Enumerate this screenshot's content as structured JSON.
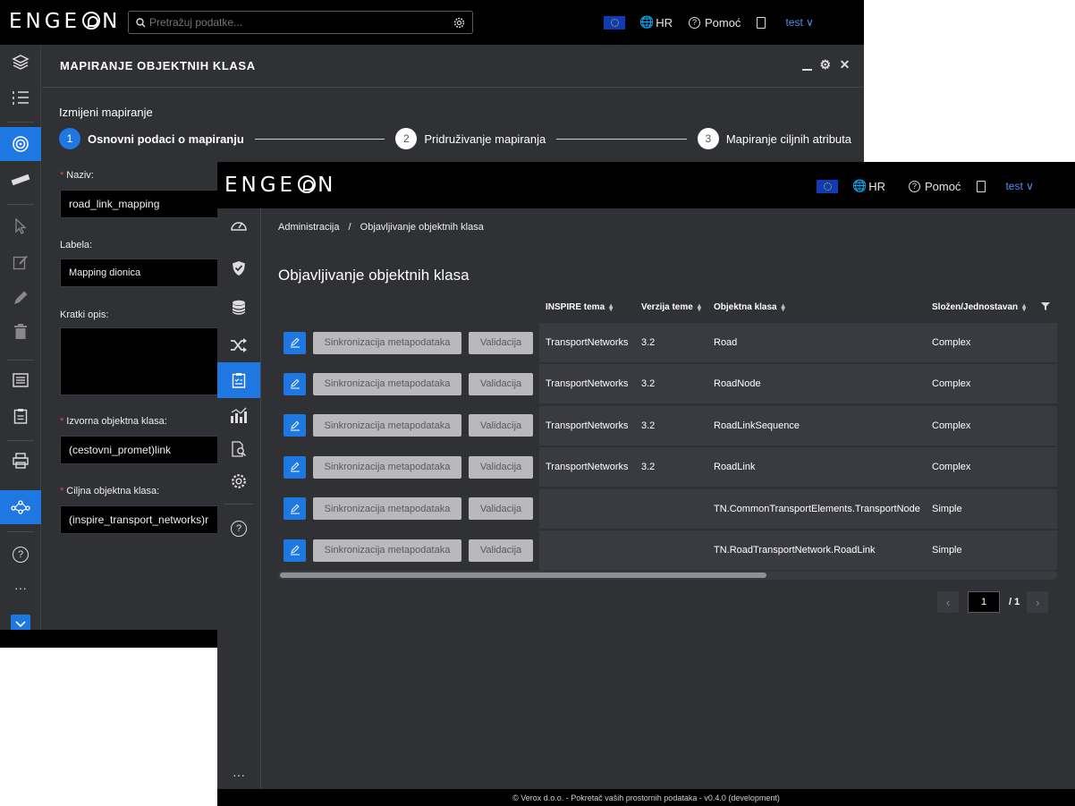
{
  "app": {
    "logo": "ENGEON",
    "language": "HR",
    "help_label": "Pomoć",
    "user_label": "test",
    "accent_color": "#1f78e1"
  },
  "search": {
    "placeholder": "Pretražuj podatke..."
  },
  "mapping_window": {
    "title": "MAPIRANJE OBJEKTNIH KLASA",
    "window_controls": [
      "minimize-icon",
      "gear-icon",
      "close-icon"
    ],
    "subtitle": "Izmijeni mapiranje",
    "steps": [
      {
        "num": "1",
        "label": "Osnovni podaci o mapiranju",
        "state": "current"
      },
      {
        "num": "2",
        "label": "Pridruživanje mapiranja",
        "state": "pending"
      },
      {
        "num": "3",
        "label": "Mapiranje ciljnih atributa",
        "state": "pending"
      }
    ],
    "fields": {
      "naziv": {
        "label": "Naziv:",
        "required": true,
        "value": "road_link_mapping"
      },
      "labela": {
        "label": "Labela:",
        "required": false,
        "value": "Mapping dionica"
      },
      "opis": {
        "label": "Kratki opis:",
        "required": false,
        "value": ""
      },
      "izvorna": {
        "label": "Izvorna objektna klasa:",
        "required": true,
        "value": "(cestovni_promet)link"
      },
      "ciljna": {
        "label": "Ciljna objektna klasa:",
        "required": true,
        "value": "(inspire_transport_networks)r"
      }
    }
  },
  "publish_window": {
    "breadcrumb": {
      "root": "Administracija",
      "separator": "/",
      "current": "Objavljivanje objektnih klasa"
    },
    "title": "Objavljivanje objektnih klasa",
    "columns": {
      "theme": "INSPIRE tema",
      "version": "Verzija teme",
      "class": "Objektna klasa",
      "type": "Složen/Jednostavan"
    },
    "actions": {
      "sync": "Sinkronizacija metapodataka",
      "validate": "Validacija"
    },
    "rows": [
      {
        "theme": "TransportNetworks",
        "version": "3.2",
        "class": "Road",
        "type": "Complex"
      },
      {
        "theme": "TransportNetworks",
        "version": "3.2",
        "class": "RoadNode",
        "type": "Complex"
      },
      {
        "theme": "TransportNetworks",
        "version": "3.2",
        "class": "RoadLinkSequence",
        "type": "Complex"
      },
      {
        "theme": "TransportNetworks",
        "version": "3.2",
        "class": "RoadLink",
        "type": "Complex"
      },
      {
        "theme": "",
        "version": "",
        "class": "TN.CommonTransportElements.TransportNode",
        "type": "Simple"
      },
      {
        "theme": "",
        "version": "",
        "class": "TN.RoadTransportNetwork.RoadLink",
        "type": "Simple"
      }
    ],
    "pagination": {
      "current": "1",
      "total": "/ 1"
    },
    "footer": "© Verox d.o.o. - Pokretač vaših prostornih podataka - v0.4.0 (development)"
  }
}
